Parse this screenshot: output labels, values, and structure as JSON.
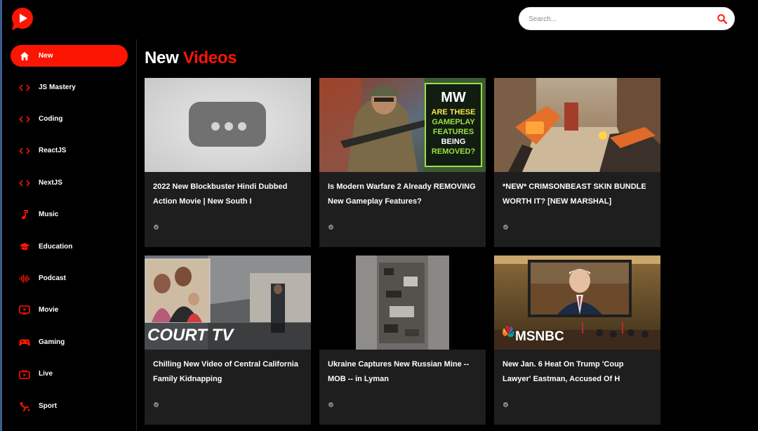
{
  "search": {
    "placeholder": "Search..."
  },
  "sidebar": {
    "items": [
      {
        "label": "New",
        "icon": "home-icon",
        "active": true
      },
      {
        "label": "JS Mastery",
        "icon": "code-icon"
      },
      {
        "label": "Coding",
        "icon": "code-icon"
      },
      {
        "label": "ReactJS",
        "icon": "code-icon"
      },
      {
        "label": "NextJS",
        "icon": "code-icon"
      },
      {
        "label": "Music",
        "icon": "music-note-icon"
      },
      {
        "label": "Education",
        "icon": "graduation-cap-icon"
      },
      {
        "label": "Podcast",
        "icon": "soundwave-icon"
      },
      {
        "label": "Movie",
        "icon": "play-screen-icon"
      },
      {
        "label": "Gaming",
        "icon": "gamepad-icon"
      },
      {
        "label": "Live",
        "icon": "live-tv-icon"
      },
      {
        "label": "Sport",
        "icon": "sport-icon"
      }
    ]
  },
  "main": {
    "heading_prefix": "New",
    "heading_accent": "Videos",
    "videos": [
      {
        "title": "2022 New Blockbuster Hindi Dubbed Action Movie | New South I",
        "thumbnail": "placeholder-thumbnail"
      },
      {
        "title": "Is Modern Warfare 2 Already REMOVING New Gameplay Features?",
        "thumbnail": "soldier-thumbnail",
        "overlay_logo": "MW",
        "overlay_text": "ARE THESE GAMEPLAY FEATURES BEING REMOVED?"
      },
      {
        "title": "*NEW* CRIMSONBEAST SKIN BUNDLE WORTH IT? [NEW MARSHAL]",
        "thumbnail": "game-weapons-thumbnail"
      },
      {
        "title": "Chilling New Video of Central California Family Kidnapping",
        "thumbnail": "court-tv-thumbnail",
        "overlay_logo": "COURT TV"
      },
      {
        "title": "Ukraine Captures New Russian Mine -- MOB -- in Lyman",
        "thumbnail": "mine-thumbnail"
      },
      {
        "title": "New Jan. 6 Heat On Trump 'Coup Lawyer' Eastman, Accused Of H",
        "thumbnail": "msnbc-thumbnail",
        "overlay_logo": "MSNBC"
      }
    ]
  },
  "colors": {
    "accent": "#fc1503",
    "background": "#000000",
    "card": "#1e1e1e"
  }
}
